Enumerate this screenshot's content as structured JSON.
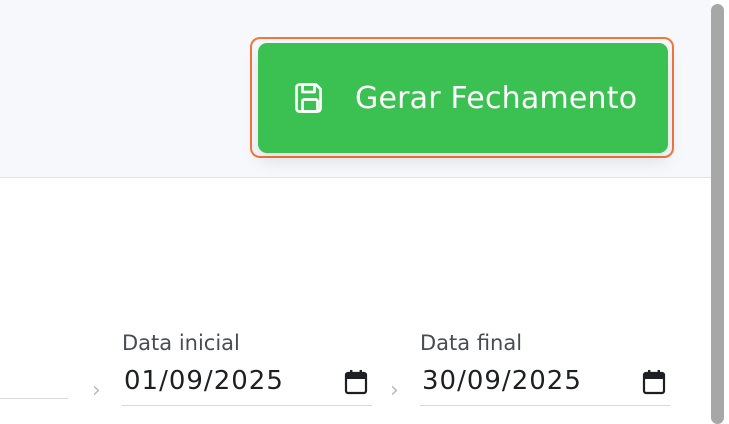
{
  "header": {
    "generate_button": {
      "label": "Gerar Fechamento",
      "icon": "save-icon",
      "color": "#3ac152",
      "focus_ring_color": "#f0773e"
    }
  },
  "filters": {
    "start_date": {
      "label": "Data inicial",
      "value": "01/09/2025",
      "icon": "calendar-icon"
    },
    "end_date": {
      "label": "Data final",
      "value": "30/09/2025",
      "icon": "calendar-icon"
    }
  }
}
